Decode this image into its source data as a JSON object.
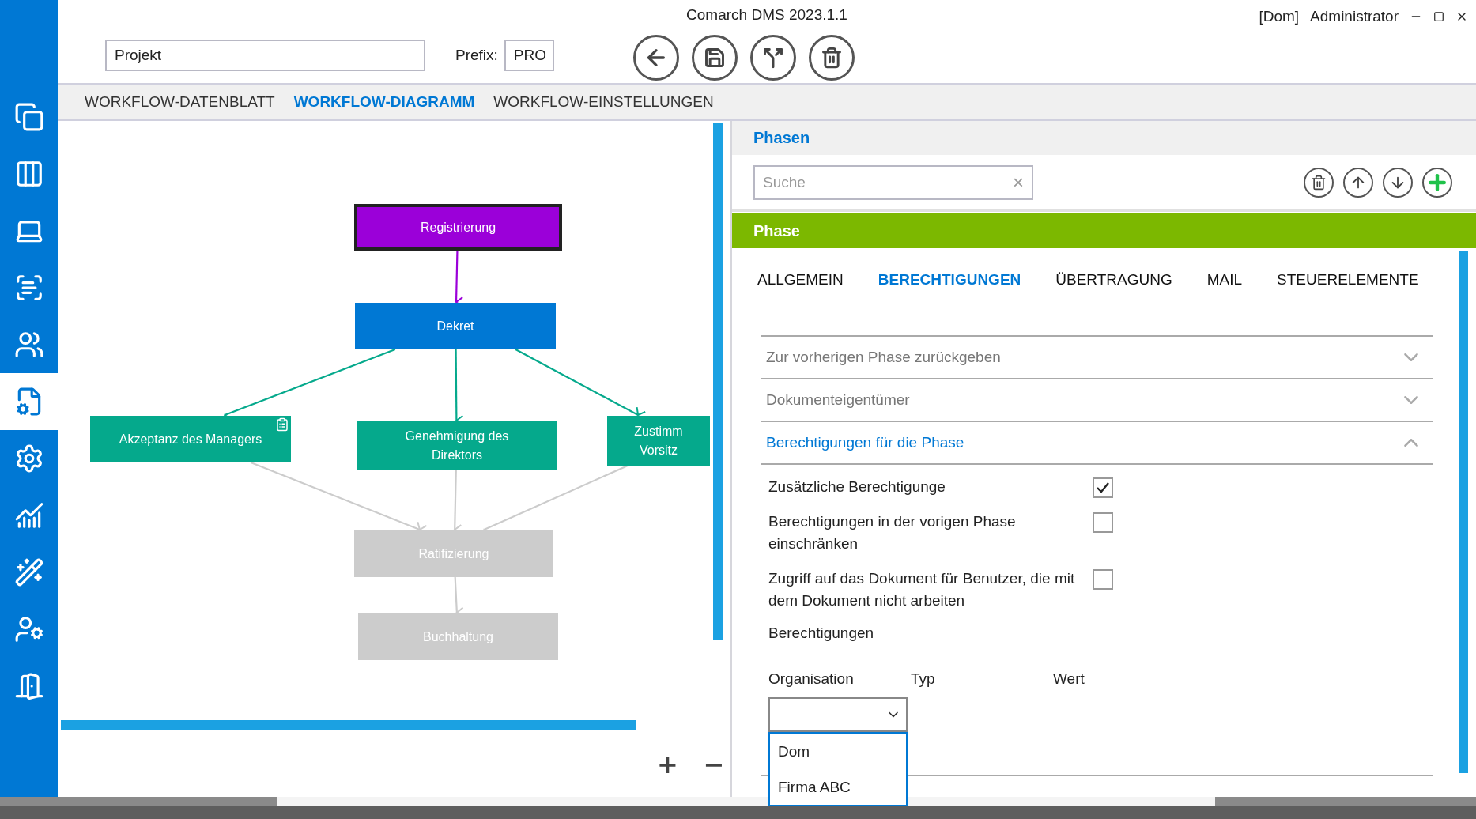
{
  "window": {
    "title": "Comarch DMS 2023.1.1",
    "domain": "[Dom]",
    "user": "Administrator"
  },
  "sidebar": {
    "items": [
      {
        "selected": false
      },
      {
        "selected": false
      },
      {
        "selected": false
      },
      {
        "selected": false
      },
      {
        "selected": false
      },
      {
        "selected": true
      },
      {
        "selected": false
      },
      {
        "selected": false
      },
      {
        "selected": false
      },
      {
        "selected": false
      },
      {
        "selected": false
      }
    ]
  },
  "header": {
    "name_value": "Projekt",
    "prefix_label": "Prefix:",
    "prefix_value": "PRO"
  },
  "tabs": [
    {
      "label": "WORKFLOW-DATENBLATT",
      "selected": false
    },
    {
      "label": "WORKFLOW-DIAGRAMM",
      "selected": true
    },
    {
      "label": "WORKFLOW-EINSTELLUNGEN",
      "selected": false
    }
  ],
  "diagram": {
    "nodes": [
      {
        "label": "Registrierung",
        "kind": "start",
        "note": false
      },
      {
        "label": "Dekret",
        "kind": "current",
        "note": false
      },
      {
        "label": "Akzeptanz des Managers",
        "kind": "next",
        "note": true
      },
      {
        "label": "Genehmigung des\nDirektors",
        "kind": "next",
        "note": false
      },
      {
        "label": "Zustimm\nVorsitz",
        "kind": "next",
        "note": false
      },
      {
        "label": "Ratifizierung",
        "kind": "pending",
        "note": false
      },
      {
        "label": "Buchhaltung",
        "kind": "pending",
        "note": false
      }
    ],
    "zoom_controls": [
      "+",
      "−"
    ]
  },
  "phases": {
    "title": "Phasen",
    "search": {
      "placeholder": "Suche",
      "clear": "×"
    },
    "section_title": "Phase",
    "tabs": [
      {
        "label": "ALLGEMEIN",
        "selected": false
      },
      {
        "label": "BERECHTIGUNGEN",
        "selected": true
      },
      {
        "label": "ÜBERTRAGUNG",
        "selected": false
      },
      {
        "label": "MAIL",
        "selected": false
      },
      {
        "label": "STEUERELEMENTE",
        "selected": false
      }
    ],
    "sections": [
      {
        "title": "Zur vorherigen Phase zurückgeben",
        "expanded": false
      },
      {
        "title": "Dokumenteigentümer",
        "expanded": false
      },
      {
        "title": "Berechtigungen für die Phase",
        "expanded": true
      }
    ],
    "options": [
      {
        "label": "Zusätzliche Berechtigunge",
        "checked": true
      },
      {
        "label": "Berechtigungen in der vorigen Phase einschränken",
        "checked": false
      },
      {
        "label": "Zugriff auf das Dokument für Benutzer, die mit dem Dokument nicht arbeiten",
        "checked": false
      }
    ],
    "permissions_label": "Berechtigungen",
    "columns": [
      "Organisation",
      "Typ",
      "Wert"
    ],
    "organisation_dropdown": {
      "expanded": true,
      "options": [
        "Dom",
        "Firma ABC"
      ]
    }
  }
}
